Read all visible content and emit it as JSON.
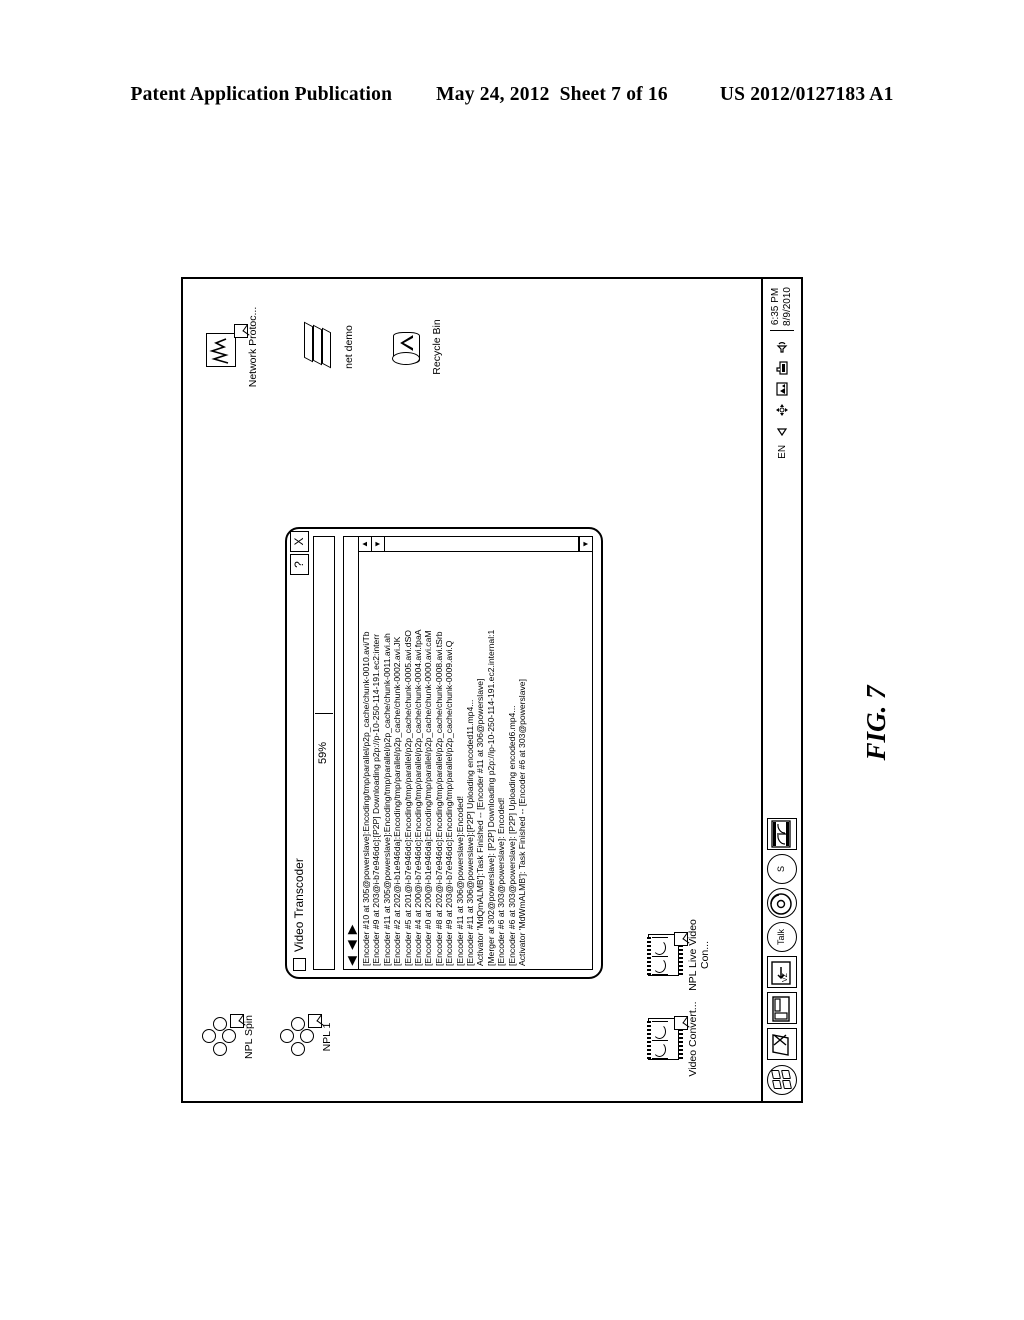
{
  "patent_header": {
    "publication": "Patent Application Publication",
    "date": "May 24, 2012",
    "sheet": "Sheet 7 of 16",
    "number": "US 2012/0127183 A1"
  },
  "figure_label": "FIG. 7",
  "desktop": {
    "icons_left": [
      {
        "name": "npl-spin",
        "label": "NPL Spin",
        "glyph": "cluster-shortcut-icon"
      },
      {
        "name": "npl-1",
        "label": "NPL 1",
        "glyph": "cluster-shortcut-icon"
      }
    ],
    "icons_bottom_left": [
      {
        "name": "video-convert",
        "label": "Video Convert...",
        "glyph": "film-strip-shortcut-icon"
      },
      {
        "name": "npl-live-video-con",
        "label": "NPL Live Video Con...",
        "glyph": "film-strip-shortcut-icon"
      }
    ],
    "icons_right": [
      {
        "name": "network-protocol",
        "label": "Network Protoc...",
        "glyph": "waveform-shortcut-icon"
      },
      {
        "name": "net-demo",
        "label": "net demo",
        "glyph": "stacked-papers-icon"
      },
      {
        "name": "recycle-bin",
        "label": "Recycle Bin",
        "glyph": "recycle-bin-icon"
      }
    ]
  },
  "window": {
    "title": "Video Transcoder",
    "buttons": {
      "help": "?",
      "close": "X"
    },
    "progress": {
      "percent_label": "59%",
      "percent": 59
    },
    "log_lines": [
      "[Encoder #10 at 305@powerslave]:Encoding/tmp/parallel/p2p_cache/chunk-0010.avi/Tb",
      "[Encoder #9 at 203@i-b7e946dc]:[P2P] Downloading p2p://p-10-250-114-191.ec2:interr",
      "[Encoder #11 at 305@powerslave]:Encoding/tmp/parallel/p2p_cache/chunk-0011.avi.ah",
      "[Encoder #2 at 202@i-b1e946da]:Encoding/tmp/parallel/p2p_cache/chunk-0002.avi.JK",
      "[Encoder #5 at 201@i-b7e946dc]:Encoding/tmp/parallel/p2p_cache/chunk-0005.avi.dSO",
      "[Encoder #4 at 200@i-b7e946dc]:Encoding/tmp/parallel/p2p_cache/chunk-0004.avi.fpaA",
      "[Encoder #0 at 200@i-b1e946da]:Encoding/tmp/parallel/p2p_cache/chunk-0000.avi.caM",
      "[Encoder #8 at 202@i-b7e946dc]:Encoding/tmp/parallel/p2p_cache/chunk-0008.avi.tSrb",
      "[Encoder #9 at 203@i-b7e946dc]:Encoding/tmp/parallel/p2p_cache/chunk-0009.avi.Q",
      "[Encoder #11 at 306@powerslave]:Encoded!",
      "[Encoder #11 at 306@powerslave]:[P2P] Uploading encoded11.mp4...",
      "Activator 'MdQmALMB']:Task Finished -- [Encoder #11 at 306@powerslave]",
      "[Merger at 302@powerslave]: [P2P] Downloading p2p://ip-10-250-114-191.ec2.internal:1",
      "[Encoder #6 at 303@powerslave]: Encoded!",
      "[Encoder #6 at 303@powerslave]: [P2P] Uploading encoded6.mp4...",
      "Activator 'MdWmALMB']: Task Finished -- [Encoder #6 at 303@powerslave]"
    ],
    "scroll": {
      "up_arrow": "▲",
      "down_arrow": "▼",
      "left_arrow": "◄",
      "right_arrow": "►"
    }
  },
  "taskbar": {
    "start_button": "start-orb-icon",
    "quick_launch": [
      {
        "name": "show-desktop",
        "glyph": "desktop-page-icon"
      },
      {
        "name": "window-switcher",
        "glyph": "window-panes-icon"
      },
      {
        "name": "vz-shortcut",
        "glyph": "vz-arrow-icon",
        "text": "←"
      },
      {
        "name": "talk",
        "glyph": "talk-bubble-icon",
        "text": "Talk"
      },
      {
        "name": "media-player",
        "glyph": "media-player-icon"
      },
      {
        "name": "skype",
        "glyph": "skype-icon",
        "text": "S"
      },
      {
        "name": "video-transcoder-task",
        "glyph": "film-strip-icon"
      }
    ],
    "tray": {
      "language": "EN",
      "icons": [
        "show-hidden-arrow-icon",
        "network-move-icon",
        "display-image-icon",
        "hand-security-icon",
        "volume-icon"
      ],
      "time": "6:35 PM",
      "date": "8/9/2010"
    }
  }
}
